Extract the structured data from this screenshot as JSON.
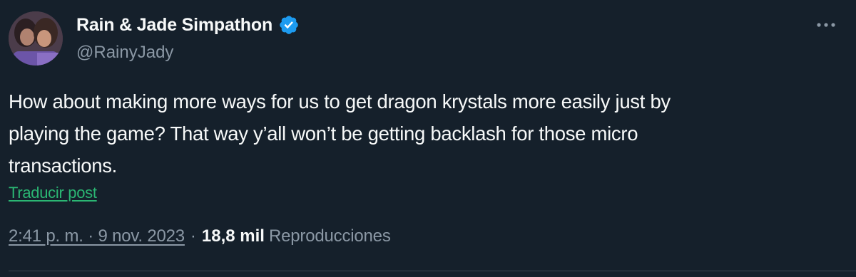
{
  "author": {
    "display_name": "Rain & Jade Simpathon",
    "handle": "@RainyJady",
    "verified": true
  },
  "tweet": {
    "text": "How about making more ways for us to get dragon krystals more easily just by\nplaying the game? That way y’all won’t be getting backlash for those micro\ntransactions.",
    "translate_label": "Traducir post",
    "timestamp": "2:41 p. m. · 9 nov. 2023",
    "separator": "·",
    "views_count": "18,8 mil",
    "views_label": "Reproducciones"
  },
  "icons": {
    "more": "more-horizontal-icon",
    "verified": "verified-badge-icon"
  },
  "colors": {
    "background": "#15202b",
    "primary_text": "#f7f9f9",
    "secondary_text": "#8b98a5",
    "verified": "#1d9bf0",
    "translate_link": "#2bb673"
  }
}
